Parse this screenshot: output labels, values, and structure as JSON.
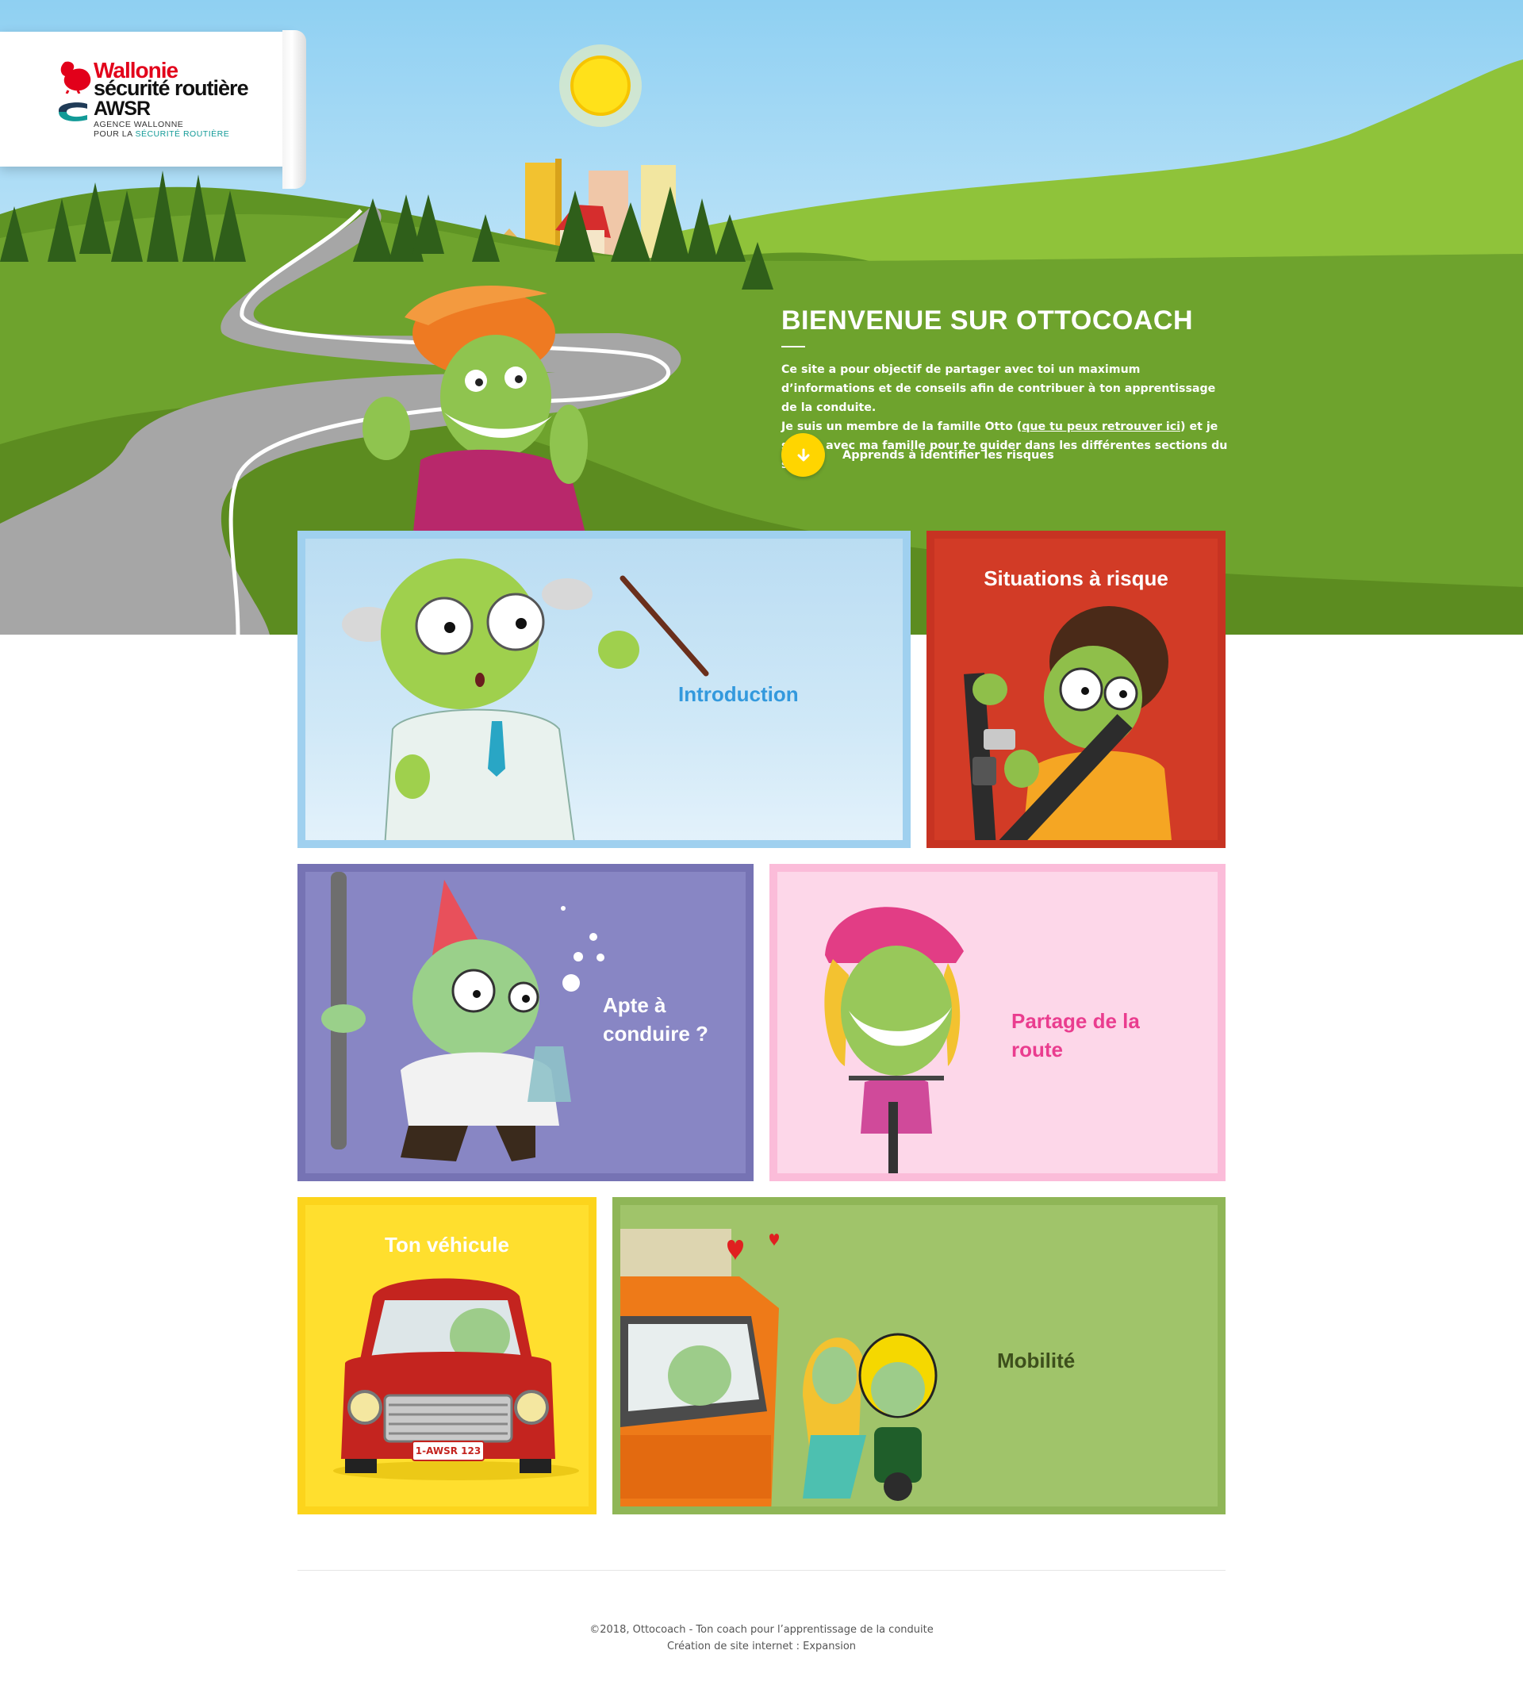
{
  "header": {
    "logo": {
      "line1": "Wallonie",
      "line2": "sécurité routière",
      "line3": "AWSR",
      "line4": "AGENCE WALLONNE",
      "line5_prefix": "POUR LA ",
      "line5_highlight": "SÉCURITÉ ROUTIÈRE",
      "icons": [
        "rooster-icon",
        "awsr-mark-icon"
      ]
    }
  },
  "hero": {
    "title": "BIENVENUE SUR OTTOCOACH",
    "intro_part1": "Ce site a pour objectif de partager avec toi un maximum d’informations et de conseils afin de contribuer à ton apprentissage de la conduite.",
    "intro_part2_before": "Je suis un membre de la famille Otto (",
    "intro_link": "que tu peux retrouver ici",
    "intro_part2_after": ") et je suis là avec ma famille pour te guider dans les différentes sections du site.",
    "cta_label": "Apprends à identifier les risques",
    "cta_icon": "arrow-down-icon"
  },
  "tiles": [
    {
      "label": "Introduction"
    },
    {
      "label": "Situations à risque"
    },
    {
      "label": "Apte à conduire ?"
    },
    {
      "label": "Partage de la route"
    },
    {
      "label": "Ton véhicule"
    },
    {
      "label": "Mobilité"
    }
  ],
  "vehicle_plate": "1-AWSR 123",
  "footer": {
    "line1": "©2018, Ottocoach - Ton coach pour l’apprentissage de la conduite",
    "line2": "Création de site internet : Expansion"
  },
  "colors": {
    "hill_green": "#6e9e28",
    "accent_yellow": "#ffd500",
    "intro_blue": "#3399dd",
    "pink_label": "#ea3d8f",
    "mobilite_label": "#3d4f1c"
  }
}
